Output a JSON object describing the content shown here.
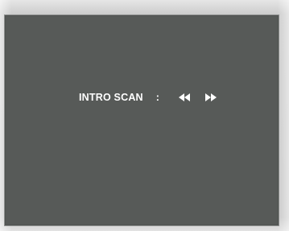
{
  "osd": {
    "label": "INTRO SCAN",
    "separator": ":",
    "controls": [
      {
        "name": "rewind",
        "icon": "rewind-icon"
      },
      {
        "name": "fast-forward",
        "icon": "fast-forward-icon"
      }
    ]
  },
  "colors": {
    "screen_background": "#575a58",
    "text": "#ffffff",
    "bezel": "#cfcfcf"
  }
}
